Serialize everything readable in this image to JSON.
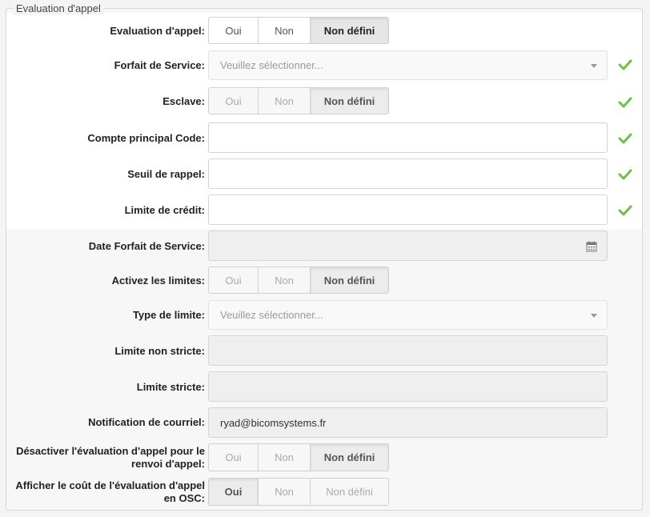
{
  "fieldset": {
    "legend": "Evaluation d'appel"
  },
  "segment_options": {
    "yes": "Oui",
    "no": "Non",
    "undefined": "Non défini"
  },
  "rows": {
    "evaluation": {
      "label": "Evaluation d'appel:"
    },
    "forfait": {
      "label": "Forfait de Service:",
      "placeholder": "Veuillez sélectionner..."
    },
    "esclave": {
      "label": "Esclave:"
    },
    "compte": {
      "label": "Compte principal Code:",
      "value": ""
    },
    "seuil": {
      "label": "Seuil de rappel:",
      "value": ""
    },
    "limite_credit": {
      "label": "Limite de crédit:",
      "value": ""
    },
    "date_forfait": {
      "label": "Date Forfait de Service:",
      "value": ""
    },
    "activez": {
      "label": "Activez les limites:"
    },
    "type_limite": {
      "label": "Type de limite:",
      "placeholder": "Veuillez sélectionner..."
    },
    "limite_non_stricte": {
      "label": "Limite non stricte:",
      "value": ""
    },
    "limite_stricte": {
      "label": "Limite stricte:",
      "value": ""
    },
    "notification": {
      "label": "Notification de courriel:",
      "value": "ryad@bicomsystems.fr"
    },
    "desactiver": {
      "label_line1": "Désactiver l'évaluation d'appel pour le",
      "label_line2": "renvoi d'appel:"
    },
    "afficher": {
      "label_line1": "Afficher le coût de l'évaluation d'appel",
      "label_line2": "en OSC:"
    }
  },
  "colors": {
    "check": "#6cc04a"
  }
}
